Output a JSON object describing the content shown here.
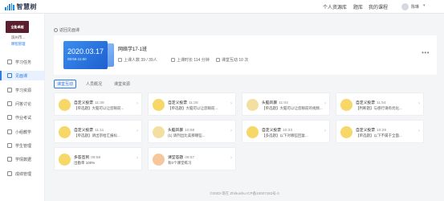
{
  "topbar": {
    "logo_text": "智慧树",
    "nav": [
      "个人资源库",
      "题库",
      "我的课程"
    ],
    "user_name": "陈琳"
  },
  "sidebar": {
    "school_badge": "全能卓越",
    "school_name": "滨州市...",
    "school_link": "课程管理",
    "items": [
      {
        "label": "学习任务",
        "active": false
      },
      {
        "label": "见面课",
        "active": true
      },
      {
        "label": "学习资源",
        "active": false
      },
      {
        "label": "问答讨论",
        "active": false
      },
      {
        "label": "作业考试",
        "active": false
      },
      {
        "label": "小组教学",
        "active": false
      },
      {
        "label": "学生管理",
        "active": false
      },
      {
        "label": "学情数据",
        "active": false
      },
      {
        "label": "成绩管理",
        "active": false
      }
    ]
  },
  "breadcrumb": "返回见面课",
  "class_card": {
    "date": "2020.03.17",
    "time": "09:56-11:50",
    "class_name": "网络学17-1班",
    "stats": [
      {
        "label": "上课人数",
        "value": "39 / 39人"
      },
      {
        "label": "上课时长",
        "value": "114 分钟"
      },
      {
        "label": "课堂互动",
        "value": "10 次"
      }
    ]
  },
  "tabs": [
    "课堂互动",
    "人员概况",
    "课堂资源"
  ],
  "activities": [
    {
      "icon": "yellow",
      "title": "自定义投票",
      "time": "11:38",
      "desc": "【单选题】大脑可以让您眼前..."
    },
    {
      "icon": "yellow",
      "title": "自定义投票",
      "time": "11:25",
      "desc": "【单选题】大脑可以让您眼前..."
    },
    {
      "icon": "green",
      "title": "头脑风暴",
      "time": "11:04",
      "desc": "【单选题】大脑可以让您眼前的视频..."
    },
    {
      "icon": "yellow",
      "title": "自定义投票",
      "time": "11:54",
      "desc": "【判断题】与感行请有优化..."
    },
    {
      "icon": "yellow",
      "title": "自定义投票",
      "time": "11:11",
      "desc": "【单选题】请出宗给汇报标..."
    },
    {
      "icon": "green",
      "title": "头脑风暴",
      "time": "10:58",
      "desc": "(1) 请列出比美那哪些..."
    },
    {
      "icon": "yellow",
      "title": "自定义投票",
      "time": "10:33",
      "desc": "【多选题】以下对哪些回复..."
    },
    {
      "icon": "yellow",
      "title": "自定义投票",
      "time": "10:29",
      "desc": "【单选题】以下不属于全面..."
    },
    {
      "icon": "yellow",
      "title": "多答签到",
      "time": "09:58",
      "desc": "出勤率 100%"
    },
    {
      "icon": "orange",
      "title": "课堂答题",
      "time": "09:57",
      "desc": "有0个课堂练习"
    }
  ],
  "footer": "©2003-现在 Zhihuishu ICP备10007183号-3"
}
